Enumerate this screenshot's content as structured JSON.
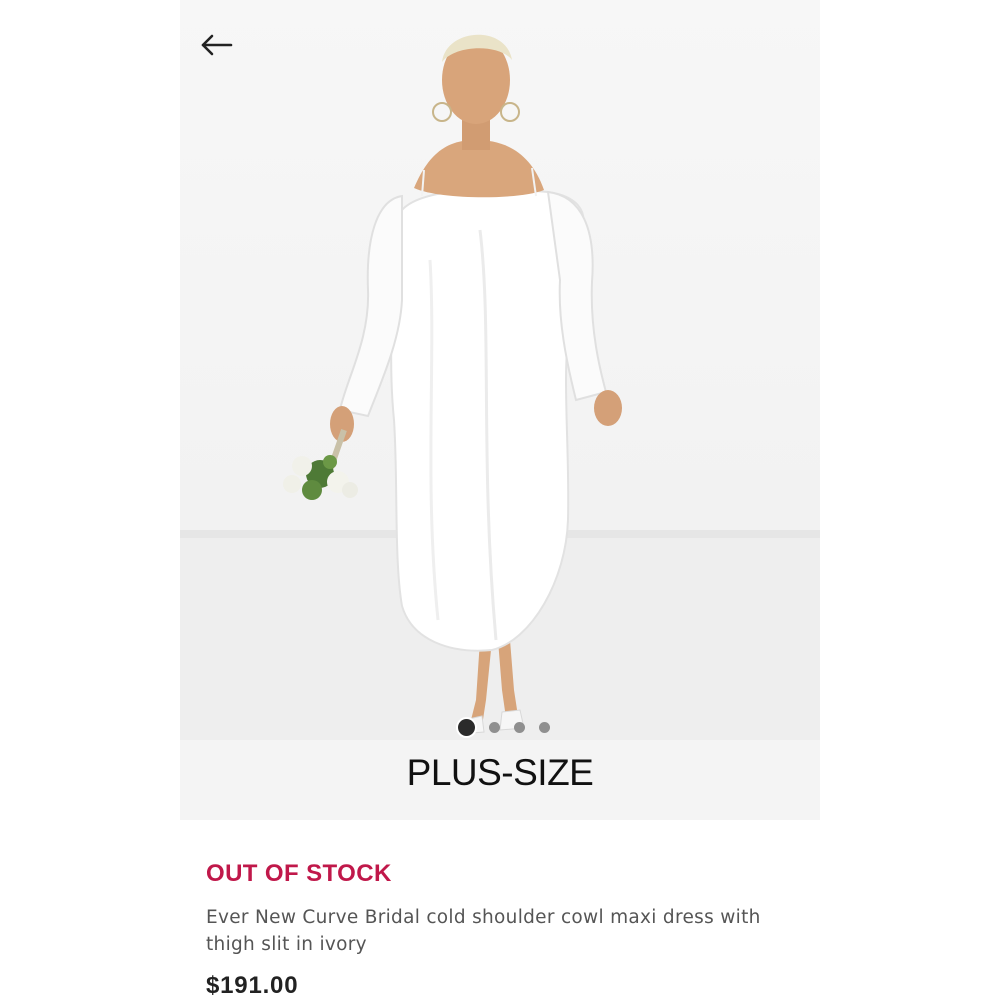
{
  "nav": {
    "back_icon": "arrow-left-icon"
  },
  "gallery": {
    "image_count": 4,
    "active_index": 0
  },
  "product": {
    "size_category": "PLUS-SIZE",
    "stock_status": "OUT OF STOCK",
    "name": "Ever New Curve Bridal cold shoulder cowl maxi dress with thigh slit in ivory",
    "price": "$191.00"
  },
  "colors": {
    "stock_status": "#c0184a",
    "price": "#222222",
    "active_dot": "#2b2b2b",
    "inactive_dot": "#8f8f8f"
  }
}
